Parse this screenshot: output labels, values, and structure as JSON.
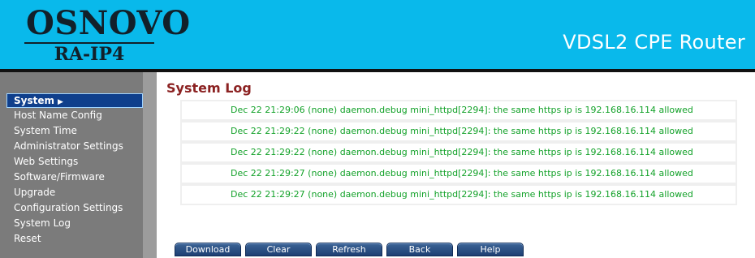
{
  "header": {
    "logo_main": "OSNOVO",
    "logo_sub": "RA-IP4",
    "router_title": "VDSL2 CPE Router"
  },
  "sidebar": {
    "active_section": "System",
    "items": [
      {
        "label": "Host Name Config"
      },
      {
        "label": "System Time"
      },
      {
        "label": "Administrator Settings"
      },
      {
        "label": "Web Settings"
      },
      {
        "label": "Software/Firmware"
      },
      {
        "label": "Upgrade"
      },
      {
        "label": "Configuration Settings"
      },
      {
        "label": "System Log"
      },
      {
        "label": "Reset"
      }
    ]
  },
  "main": {
    "title": "System Log",
    "log_entries": [
      "Dec 22 21:29:06 (none) daemon.debug mini_httpd[2294]: the same https ip is 192.168.16.114 allowed",
      "Dec 22 21:29:22 (none) daemon.debug mini_httpd[2294]: the same https ip is 192.168.16.114 allowed",
      "Dec 22 21:29:22 (none) daemon.debug mini_httpd[2294]: the same https ip is 192.168.16.114 allowed",
      "Dec 22 21:29:27 (none) daemon.debug mini_httpd[2294]: the same https ip is 192.168.16.114 allowed",
      "Dec 22 21:29:27 (none) daemon.debug mini_httpd[2294]: the same https ip is 192.168.16.114 allowed"
    ]
  },
  "buttons": {
    "download": "Download",
    "clear": "Clear",
    "refresh": "Refresh",
    "back": "Back",
    "help": "Help"
  },
  "colors": {
    "header_bg": "#09b9eb",
    "sidebar_bg": "#7b7b7b",
    "active_item_bg": "#0f3f8c",
    "title_color": "#8b2121",
    "log_text": "#14a22a",
    "button_bg": "#1e3f73"
  }
}
